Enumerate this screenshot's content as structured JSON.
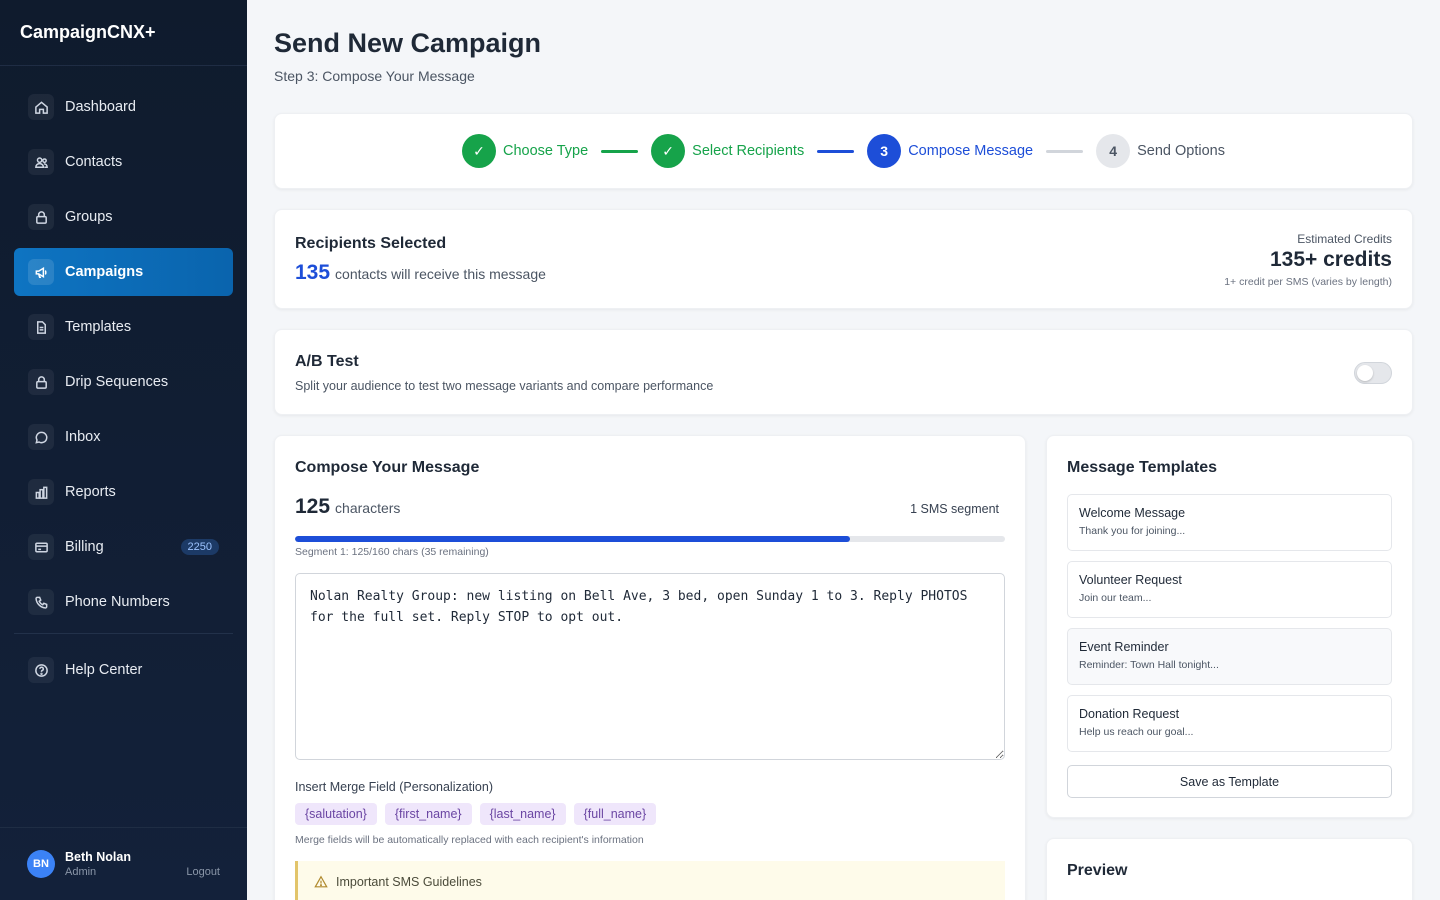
{
  "app": {
    "name": "CampaignCNX+"
  },
  "sidebar": {
    "items": [
      {
        "label": "Dashboard",
        "icon": "home-icon"
      },
      {
        "label": "Contacts",
        "icon": "users-icon"
      },
      {
        "label": "Groups",
        "icon": "lock-icon"
      },
      {
        "label": "Campaigns",
        "icon": "megaphone-icon",
        "active": true
      },
      {
        "label": "Templates",
        "icon": "document-icon"
      },
      {
        "label": "Drip Sequences",
        "icon": "lock-icon"
      },
      {
        "label": "Inbox",
        "icon": "chat-icon"
      },
      {
        "label": "Reports",
        "icon": "bar-chart-icon"
      },
      {
        "label": "Billing",
        "icon": "credit-card-icon",
        "badge": "2250"
      },
      {
        "label": "Phone Numbers",
        "icon": "phone-icon"
      }
    ],
    "help": {
      "label": "Help Center",
      "icon": "help-circle-icon"
    },
    "user": {
      "initials": "BN",
      "name": "Beth Nolan",
      "role": "Admin",
      "logout": "Logout"
    }
  },
  "page": {
    "title": "Send New Campaign",
    "subtitle": "Step 3: Compose Your Message"
  },
  "stepper": {
    "steps": [
      {
        "marker": "✓",
        "label": "Choose Type",
        "state": "done"
      },
      {
        "marker": "✓",
        "label": "Select Recipients",
        "state": "done"
      },
      {
        "marker": "3",
        "label": "Compose Message",
        "state": "current"
      },
      {
        "marker": "4",
        "label": "Send Options",
        "state": "pending"
      }
    ]
  },
  "recipients": {
    "title": "Recipients Selected",
    "count": "135",
    "count_text": "contacts will receive this message",
    "credits_label": "Estimated Credits",
    "credits_value": "135+ credits",
    "credits_note": "1+ credit per SMS (varies by length)"
  },
  "ab_test": {
    "title": "A/B Test",
    "description": "Split your audience to test two message variants and compare performance",
    "enabled": false
  },
  "compose": {
    "title": "Compose Your Message",
    "char_count": "125",
    "char_label": "characters",
    "segment_label": "1 SMS segment",
    "progress_fraction": 0.78125,
    "progress_note": "Segment 1: 125/160 chars (35 remaining)",
    "message": "Nolan Realty Group: new listing on Bell Ave, 3 bed, open Sunday 1 to 3. Reply PHOTOS for the full set. Reply STOP to opt out.",
    "merge_label": "Insert Merge Field (Personalization)",
    "merge_fields": [
      "{salutation}",
      "{first_name}",
      "{last_name}",
      "{full_name}"
    ],
    "merge_note": "Merge fields will be automatically replaced with each recipient's information",
    "guidelines_title": "Important SMS Guidelines"
  },
  "templates": {
    "title": "Message Templates",
    "items": [
      {
        "name": "Welcome Message",
        "preview": "Thank you for joining..."
      },
      {
        "name": "Volunteer Request",
        "preview": "Join our team..."
      },
      {
        "name": "Event Reminder",
        "preview": "Reminder: Town Hall tonight..."
      },
      {
        "name": "Donation Request",
        "preview": "Help us reach our goal..."
      }
    ],
    "save_label": "Save as Template"
  },
  "preview": {
    "title": "Preview"
  },
  "colors": {
    "accent": "#1d4ed8",
    "success": "#16a34a",
    "sidebar_bg": "#0f1b2d",
    "active_nav": "#0e74c2"
  }
}
